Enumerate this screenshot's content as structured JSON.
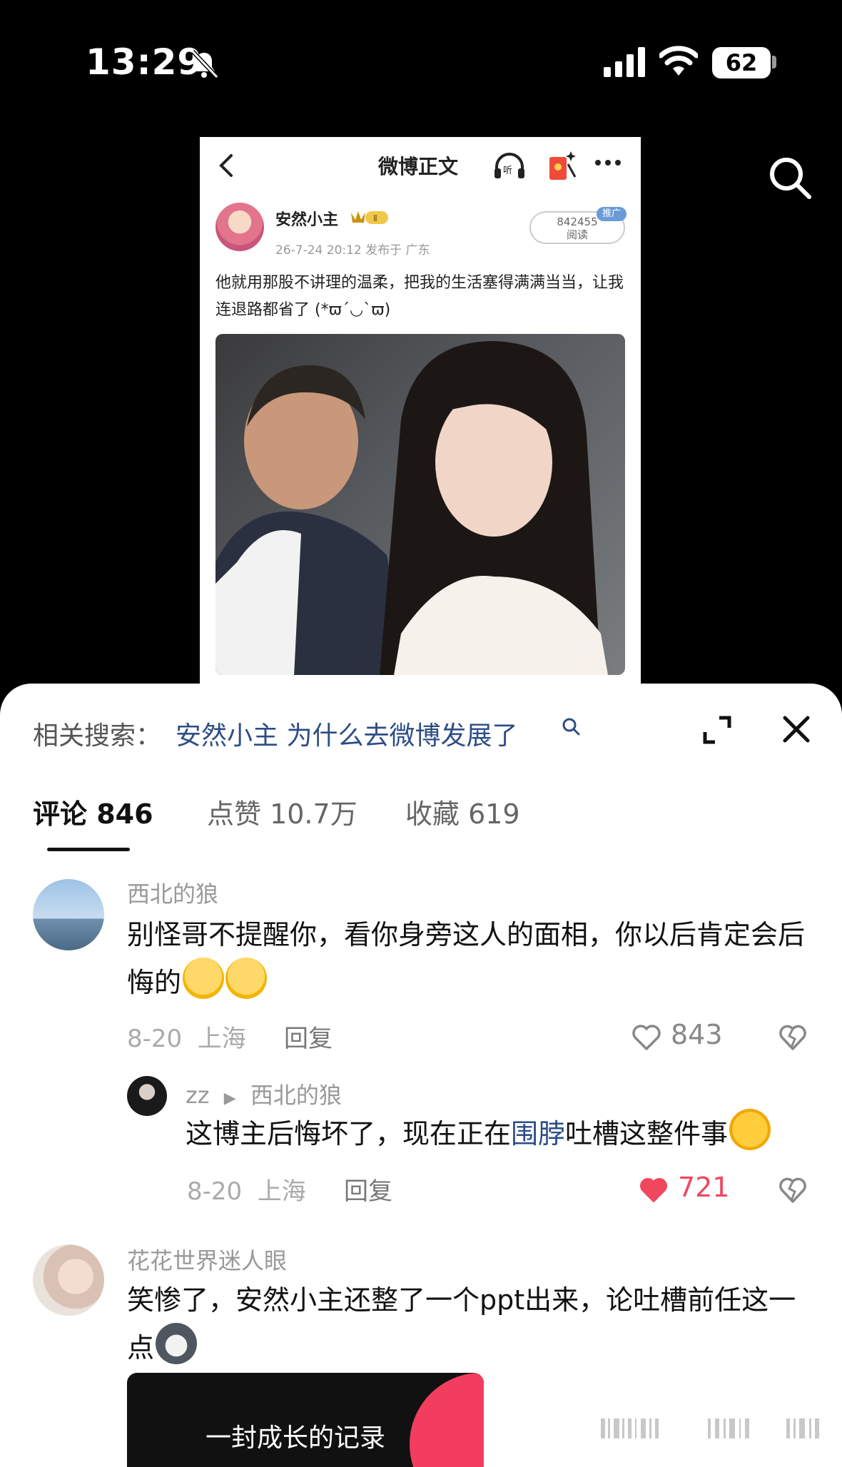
{
  "status_bar": {
    "time": "13:29",
    "battery": "62"
  },
  "weibo_post": {
    "header_title": "微博正文",
    "author": "安然小主",
    "vip_level": "Ⅱ",
    "meta": "26-7-24 20:12  发布于 广东",
    "reads_count": "842455",
    "reads_label": "阅读",
    "promo_label": "推广",
    "text": "他就用那股不讲理的温柔，把我的生活塞得满满当当，让我连退路都省了 (*ϖ´◡`ϖ)"
  },
  "related_search": {
    "label": "相关搜索：",
    "query": "安然小主 为什么去微博发展了"
  },
  "tabs": [
    {
      "label": "评论 846"
    },
    {
      "label": "点赞 10.7万"
    },
    {
      "label": "收藏 619"
    }
  ],
  "comments": [
    {
      "author": "西北的狼",
      "text": "别怪哥不提醒你，看你身旁这人的面相，你以后肯定会后悔的",
      "date": "8-20",
      "location": "上海",
      "reply_label": "回复",
      "likes": "843",
      "liked": false
    },
    {
      "author": "zz",
      "reply_to": "西北的狼",
      "text_before": "这博主后悔坏了，现在正在",
      "text_link": "围脖",
      "text_after": "吐槽这整件事",
      "date": "8-20",
      "location": "上海",
      "reply_label": "回复",
      "likes": "721",
      "liked": true
    },
    {
      "author": "花花世界迷人眼",
      "text": "笑惨了，安然小主还整了一个ppt出来，论吐槽前任这一点",
      "video_title": "一封成长的记录"
    }
  ],
  "colors": {
    "link": "#2d4d86",
    "liked_heart": "#f0475f",
    "muted": "#999999"
  }
}
